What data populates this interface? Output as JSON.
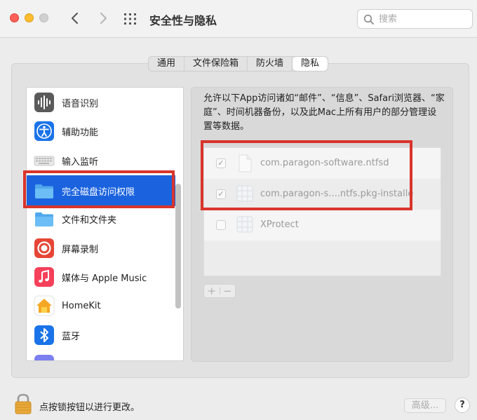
{
  "window": {
    "title": "安全性与隐私"
  },
  "search": {
    "placeholder": "搜索"
  },
  "tabs": [
    {
      "label": "通用",
      "active": false
    },
    {
      "label": "文件保险箱",
      "active": false
    },
    {
      "label": "防火墙",
      "active": false
    },
    {
      "label": "隐私",
      "active": true
    }
  ],
  "sidebar": {
    "items": [
      {
        "label": "语音识别",
        "icon": "waveform-icon"
      },
      {
        "label": "辅助功能",
        "icon": "accessibility-icon"
      },
      {
        "label": "输入监听",
        "icon": "keyboard-icon"
      },
      {
        "label": "完全磁盘访问权限",
        "icon": "folder-icon",
        "selected": true
      },
      {
        "label": "文件和文件夹",
        "icon": "folder-icon"
      },
      {
        "label": "屏幕录制",
        "icon": "screen-record-icon"
      },
      {
        "label": "媒体与 Apple Music",
        "icon": "music-icon"
      },
      {
        "label": "HomeKit",
        "icon": "home-icon"
      },
      {
        "label": "蓝牙",
        "icon": "bluetooth-icon"
      }
    ]
  },
  "detail": {
    "description": "允许以下App访问诸如“邮件”、“信息”、Safari浏览器、“家庭”、时间机器备份，以及此Mac上所有用户的部分管理设置等数据。",
    "apps": [
      {
        "name": "com.paragon-software.ntfsd",
        "checked": true
      },
      {
        "name": "com.paragon-s....ntfs.pkg-installe",
        "checked": true
      },
      {
        "name": "XProtect",
        "checked": false
      }
    ],
    "check_mark": "✓",
    "add_label": "+",
    "remove_label": "−"
  },
  "footer": {
    "lock_text": "点按锁按钮以进行更改。",
    "advanced_label": "高级...",
    "help_label": "?"
  },
  "colors": {
    "selection": "#1b63de",
    "annotation": "#d9342b"
  }
}
